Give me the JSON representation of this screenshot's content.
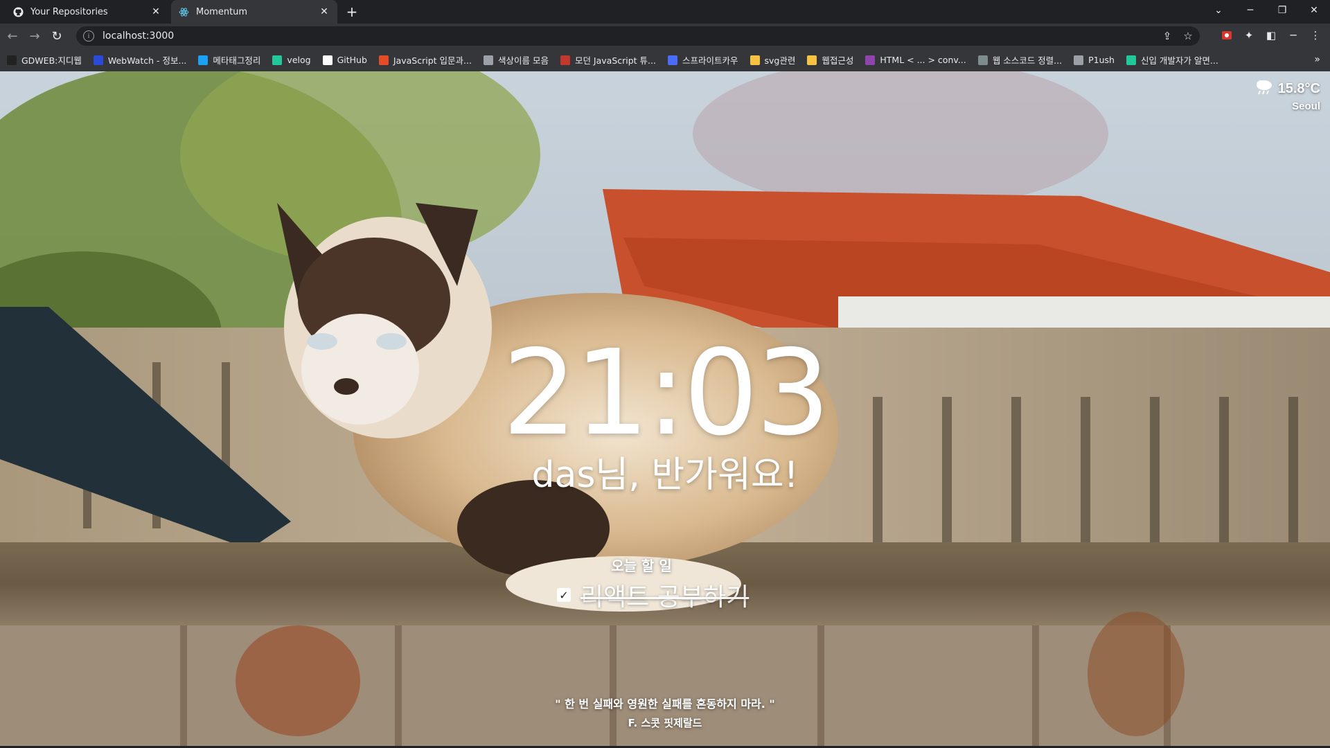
{
  "browser": {
    "tabs": [
      {
        "title": "Your Repositories",
        "icon": "github-icon"
      },
      {
        "title": "Momentum",
        "icon": "react-icon"
      }
    ],
    "address": "localhost:3000",
    "bookmarks": [
      {
        "label": "GDWEB:지디웹",
        "icon": "gdweb-icon",
        "color": "#222222"
      },
      {
        "label": "WebWatch - 정보...",
        "icon": "webwatch-icon",
        "color": "#2a4bd7"
      },
      {
        "label": "메타태그정리",
        "icon": "bird-icon",
        "color": "#1da1f2"
      },
      {
        "label": "velog",
        "icon": "velog-icon",
        "color": "#20c997"
      },
      {
        "label": "GitHub",
        "icon": "github-icon",
        "color": "#ffffff"
      },
      {
        "label": "JavaScript 입문과...",
        "icon": "apple-icon",
        "color": "#e34c26"
      },
      {
        "label": "색상이름 모음",
        "icon": "dots-icon",
        "color": "#9aa0a6"
      },
      {
        "label": "모던 JavaScript 튜...",
        "icon": "flag-icon",
        "color": "#c0392b"
      },
      {
        "label": "스프라이트카우",
        "icon": "cow-icon",
        "color": "#4a6cf7"
      },
      {
        "label": "svg관련",
        "icon": "folder-icon",
        "color": "#f6c343"
      },
      {
        "label": "웹접근성",
        "icon": "folder-icon",
        "color": "#f6c343"
      },
      {
        "label": "HTML < ... > conv...",
        "icon": "grid-icon",
        "color": "#8e44ad"
      },
      {
        "label": "웹 소스코드 정렬...",
        "icon": "tool-icon",
        "color": "#7f8c8d"
      },
      {
        "label": "P1ush",
        "icon": "dots-icon",
        "color": "#9aa0a6"
      },
      {
        "label": "신입 개발자가 알면...",
        "icon": "velog-icon",
        "color": "#20c997"
      }
    ]
  },
  "momentum": {
    "weather": {
      "temp": "15.8°C",
      "city": "Seoul",
      "icon": "cloud-rain-icon"
    },
    "clock": "21:03",
    "greeting": "das님, 반가워요!",
    "todo_title": "오늘 할 일",
    "todos": [
      {
        "text": "리액트 공부하기",
        "done": true
      }
    ],
    "quote": "\" 한 번 실패와 영원한 실패를 혼동하지 마라. \"",
    "author": "F. 스콧 핏제랄드"
  }
}
